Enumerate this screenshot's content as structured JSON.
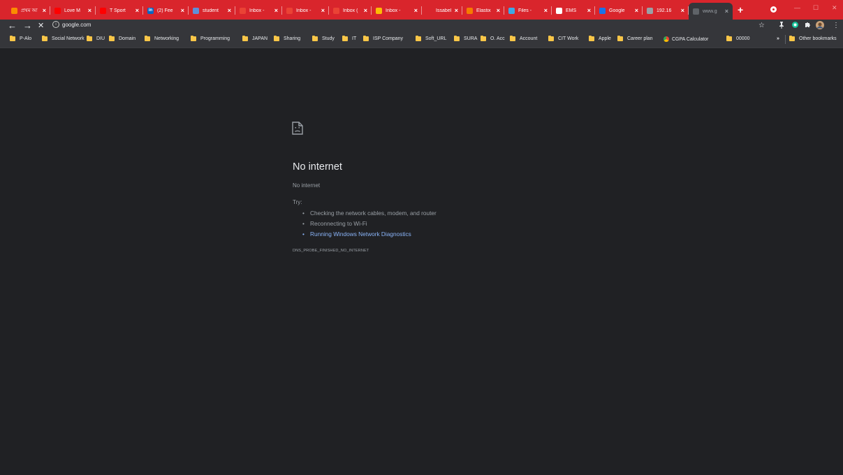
{
  "tabs": [
    {
      "title": "প্রথম আ",
      "favicon_color": "#fb8c00"
    },
    {
      "title": "Love M",
      "favicon_color": "#ff0000"
    },
    {
      "title": "T Sport",
      "favicon_color": "#ff0000"
    },
    {
      "title": "(2) Fee",
      "favicon_color": "#0a66c2",
      "favicon_text": "in"
    },
    {
      "title": "student",
      "favicon_color": "#5f8fd9"
    },
    {
      "title": "Inbox -",
      "favicon_color": "#ea4335"
    },
    {
      "title": "Inbox -",
      "favicon_color": "#ea4335"
    },
    {
      "title": "Inbox (",
      "favicon_color": "#ea4335"
    },
    {
      "title": "Inbox -",
      "favicon_color": "#fbbc05"
    },
    {
      "title": "Issabel",
      "favicon_color": "#d9252c"
    },
    {
      "title": "Elastix",
      "favicon_color": "#f57c00"
    },
    {
      "title": "Files - ",
      "favicon_color": "#3ea8e5"
    },
    {
      "title": "EMS",
      "favicon_color": "#ffffff"
    },
    {
      "title": "Google",
      "favicon_color": "#1a73e8"
    },
    {
      "title": "192.16",
      "favicon_color": "#9aa0a6"
    },
    {
      "title": "www.g",
      "favicon_color": "#5f6368",
      "active": true
    }
  ],
  "new_tab_label": "+",
  "window_controls": {
    "minimize": "—",
    "maximize": "☐",
    "close": "✕"
  },
  "toolbar": {
    "back": "←",
    "forward": "→",
    "stop": "✕",
    "info": "i",
    "url": "google.com",
    "star": "☆",
    "menu": "⋮"
  },
  "bookmarks": [
    {
      "label": "P-Alo"
    },
    {
      "label": "Social Network"
    },
    {
      "label": "DIU"
    },
    {
      "label": "Domain"
    },
    {
      "label": "Networking"
    },
    {
      "label": "Programming"
    },
    {
      "label": "JAPAN"
    },
    {
      "label": "Sharing"
    },
    {
      "label": "Study"
    },
    {
      "label": "IT"
    },
    {
      "label": "ISP Company"
    },
    {
      "label": "Soft_URL"
    },
    {
      "label": "SURA"
    },
    {
      "label": "O. Acc"
    },
    {
      "label": "Account"
    },
    {
      "label": "CIT Work"
    },
    {
      "label": "Apple"
    },
    {
      "label": "Career plan"
    },
    {
      "label": "CGPA Calculator",
      "icon": "chrome-icon"
    },
    {
      "label": "00000"
    }
  ],
  "bookmarks_overflow": "»",
  "other_bookmarks": "Other bookmarks",
  "error": {
    "title": "No internet",
    "subtitle": "No internet",
    "try_label": "Try:",
    "suggestions": [
      "Checking the network cables, modem, and router",
      "Reconnecting to Wi-Fi",
      "Running Windows Network Diagnostics"
    ],
    "code": "DNS_PROBE_FINISHED_NO_INTERNET"
  }
}
